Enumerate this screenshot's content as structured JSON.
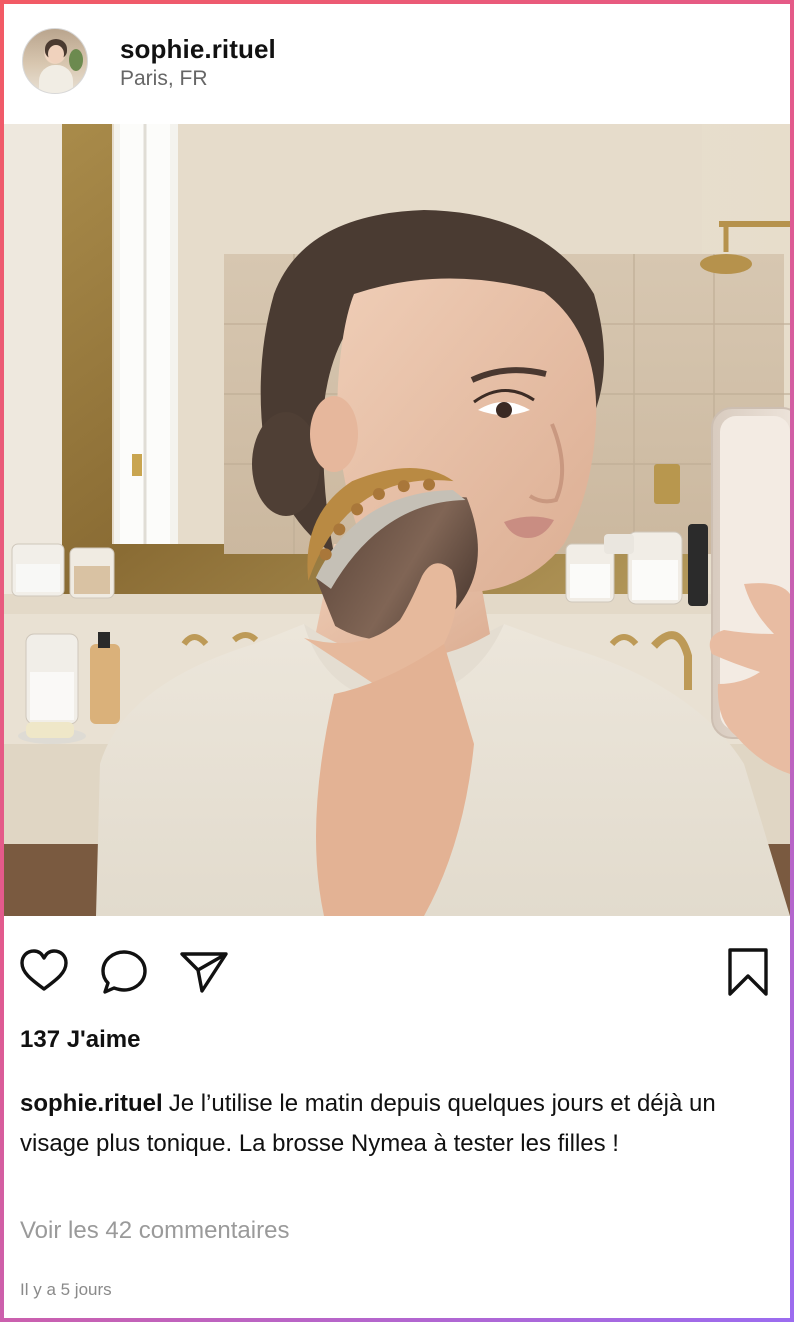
{
  "post": {
    "username": "sophie.rituel",
    "location": "Paris, FR",
    "likes": "137 J'aime",
    "caption_user": "sophie.rituel",
    "caption_text": "Je l’utilise le matin depuis quelques jours et déjà un visage plus tonique. La brosse Nymea à tester les filles !",
    "view_comments": "Voir les 42 commentaires",
    "timestamp": "Il y a 5 jours"
  },
  "icons": {
    "like": "heart-icon",
    "comment": "comment-icon",
    "share": "paper-plane-icon",
    "save": "bookmark-icon"
  },
  "colors": {
    "frame_gradient_start": "#f25a64",
    "frame_gradient_end": "#9b6cf0",
    "text_primary": "#111111",
    "text_secondary": "#9a9a9a"
  }
}
